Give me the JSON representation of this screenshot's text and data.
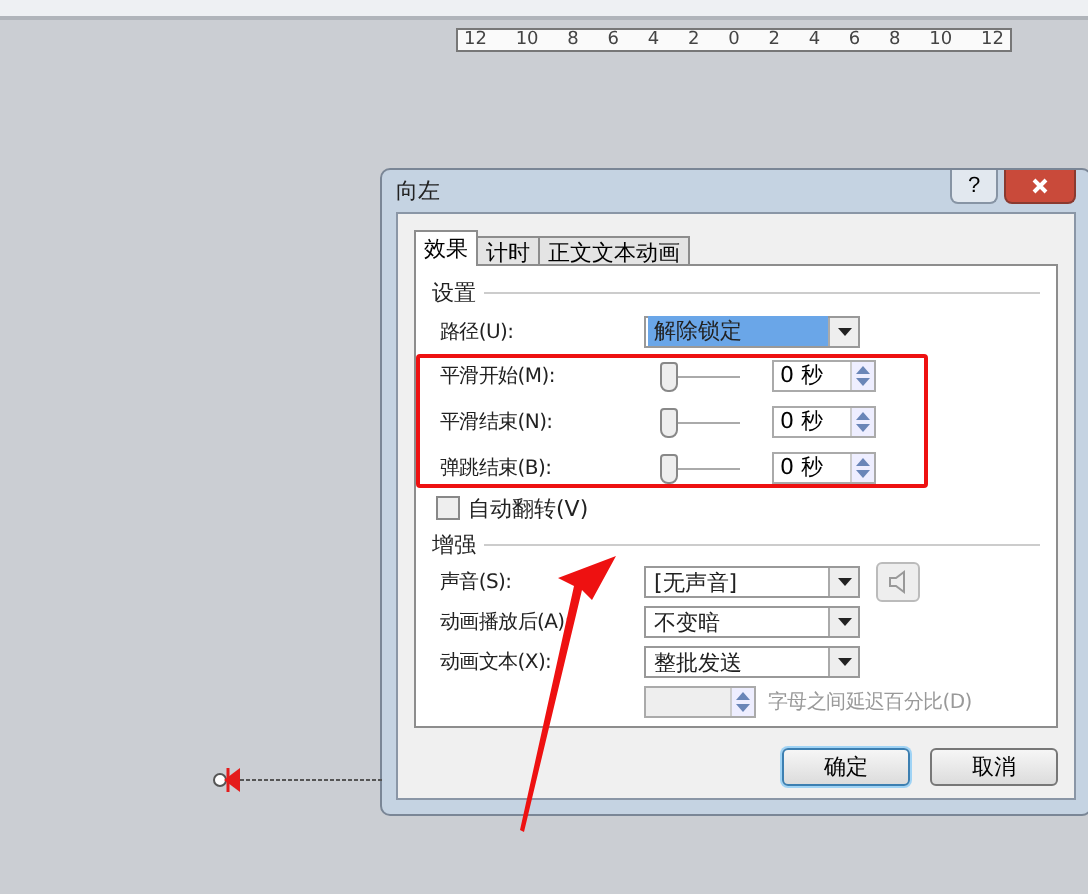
{
  "ruler": {
    "ticks": [
      "12",
      "10",
      "8",
      "6",
      "4",
      "2",
      "0",
      "2",
      "4",
      "6",
      "8",
      "10",
      "12"
    ]
  },
  "dialog": {
    "title": "向左",
    "help_button": "?",
    "tabs": [
      {
        "label": "效果",
        "selected": true
      },
      {
        "label": "计时",
        "selected": false
      },
      {
        "label": "正文文本动画",
        "selected": false
      }
    ],
    "settings": {
      "heading": "设置",
      "path": {
        "label": "路径(U):",
        "value": "解除锁定"
      },
      "sliders": [
        {
          "label": "平滑开始(M):",
          "level": 0,
          "value": "0 秒"
        },
        {
          "label": "平滑结束(N):",
          "level": 0,
          "value": "0 秒"
        },
        {
          "label": "弹跳结束(B):",
          "level": 0,
          "value": "0 秒"
        }
      ],
      "auto_reverse": {
        "label": "自动翻转(V)",
        "checked": false
      }
    },
    "enhance": {
      "heading": "增强",
      "dropdowns": [
        {
          "label": "声音(S):",
          "value": "[无声音]"
        },
        {
          "label": "动画播放后(A):",
          "value": "不变暗"
        },
        {
          "label": "动画文本(X):",
          "value": "整批发送"
        }
      ],
      "delay": {
        "label": "字母之间延迟百分比(D)",
        "disabled": true
      }
    },
    "buttons": [
      {
        "label": "确定",
        "default": true
      },
      {
        "label": "取消",
        "default": false
      }
    ]
  }
}
